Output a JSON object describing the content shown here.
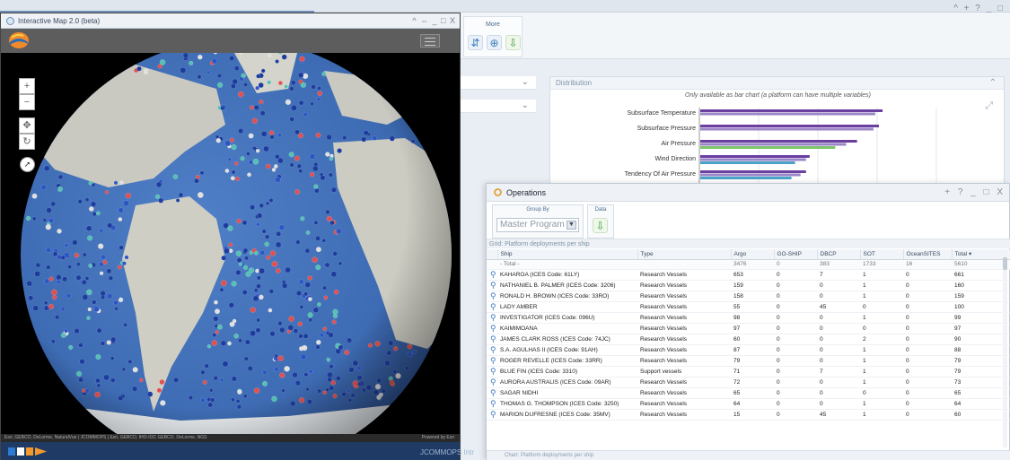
{
  "map_window": {
    "title": "Interactive Map 2.0 (beta)",
    "controls": "^ ⇔ _ □ X",
    "zoom_in": "+",
    "zoom_out": "−",
    "attribution": "Esri, GEBCO, DeLorme, NaturalVue | JCOMMOPS | Esri, GEBCO, IHO-IOC GEBCO, DeLorme, NGS",
    "powered_by": "Powered by Esri"
  },
  "ribbon": {
    "group_label": "More"
  },
  "window_controls": "^ + ? _ □",
  "distribution": {
    "header": "Distribution",
    "note": "Only available as bar chart (a platform can have multiple variables)"
  },
  "chart_data": {
    "type": "bar",
    "orientation": "horizontal",
    "categories": [
      "Subsurface Temperature",
      "Subsurface Pressure",
      "Air Pressure",
      "Wind Direction",
      "Tendency Of Air Pressure"
    ],
    "series": [
      {
        "values": [
          100,
          98,
          86,
          60,
          58
        ],
        "color": "#6a3fa0"
      },
      {
        "values": [
          96,
          95,
          80,
          58,
          55
        ],
        "color": "#9b86c7"
      },
      {
        "values": [
          0,
          0,
          74,
          0,
          0
        ],
        "color": "#7dc56a"
      },
      {
        "values": [
          0,
          0,
          0,
          52,
          50
        ],
        "color": "#4aa3c8"
      }
    ],
    "title": "",
    "xlabel": "",
    "ylabel": "",
    "xlim": [
      0,
      130
    ],
    "grid": true
  },
  "operations": {
    "title": "Operations",
    "controls": "+ ? _ □ X",
    "group_by_label": "Group By",
    "group_by_value": "Master Program",
    "data_label": "Data",
    "grid_caption": "Grid: Platform deployments per ship",
    "footer": "Chart: Platform deployments per ship",
    "columns": [
      "Ship",
      "Type",
      "Argo",
      "GO-SHIP",
      "DBCP",
      "SOT",
      "OceanSITES",
      "Total ▾"
    ],
    "total_row": [
      "- Total -",
      "",
      "3476",
      "0",
      "383",
      "1733",
      "16",
      "5610"
    ],
    "rows": [
      [
        "KAHAROA (ICES Code: 61LY)",
        "Research Vessels",
        "653",
        "0",
        "7",
        "1",
        "0",
        "661"
      ],
      [
        "NATHANIEL B. PALMER (ICES Code: 3206)",
        "Research Vessels",
        "159",
        "0",
        "0",
        "1",
        "0",
        "160"
      ],
      [
        "RONALD H. BROWN (ICES Code: 33RO)",
        "Research Vessels",
        "158",
        "0",
        "0",
        "1",
        "0",
        "159"
      ],
      [
        "LADY AMBER",
        "Research Vessels",
        "55",
        "0",
        "45",
        "0",
        "0",
        "100"
      ],
      [
        "INVESTIGATOR (ICES Code: 096U)",
        "Research Vessels",
        "98",
        "0",
        "0",
        "1",
        "0",
        "99"
      ],
      [
        "KAIMIMOANA",
        "Research Vessels",
        "97",
        "0",
        "0",
        "0",
        "0",
        "97"
      ],
      [
        "JAMES CLARK ROSS (ICES Code: 74JC)",
        "Research Vessels",
        "60",
        "0",
        "0",
        "2",
        "0",
        "90"
      ],
      [
        "S.A. AGULHAS II (ICES Code: 91AH)",
        "Research Vessels",
        "87",
        "0",
        "0",
        "1",
        "0",
        "88"
      ],
      [
        "ROGER REVELLE (ICES Code: 33RR)",
        "Research Vessels",
        "79",
        "0",
        "0",
        "1",
        "0",
        "79"
      ],
      [
        "BLUE FIN (ICES Code: 3310)",
        "Support vessels",
        "71",
        "0",
        "7",
        "1",
        "0",
        "79"
      ],
      [
        "AURORA AUSTRALIS (ICES Code: 09AR)",
        "Research Vessels",
        "72",
        "0",
        "0",
        "1",
        "0",
        "73"
      ],
      [
        "SAGAR NIDHI",
        "Research Vessels",
        "65",
        "0",
        "0",
        "0",
        "0",
        "65"
      ],
      [
        "THOMAS G. THOMPSON (ICES Code: 3250)",
        "Research Vessels",
        "64",
        "0",
        "0",
        "1",
        "0",
        "64"
      ],
      [
        "MARION DUFRESNE (ICES Code: 35MV)",
        "Research Vessels",
        "15",
        "0",
        "45",
        "1",
        "0",
        "60"
      ]
    ]
  },
  "footer_brand": "JCOMMOPS Intr"
}
